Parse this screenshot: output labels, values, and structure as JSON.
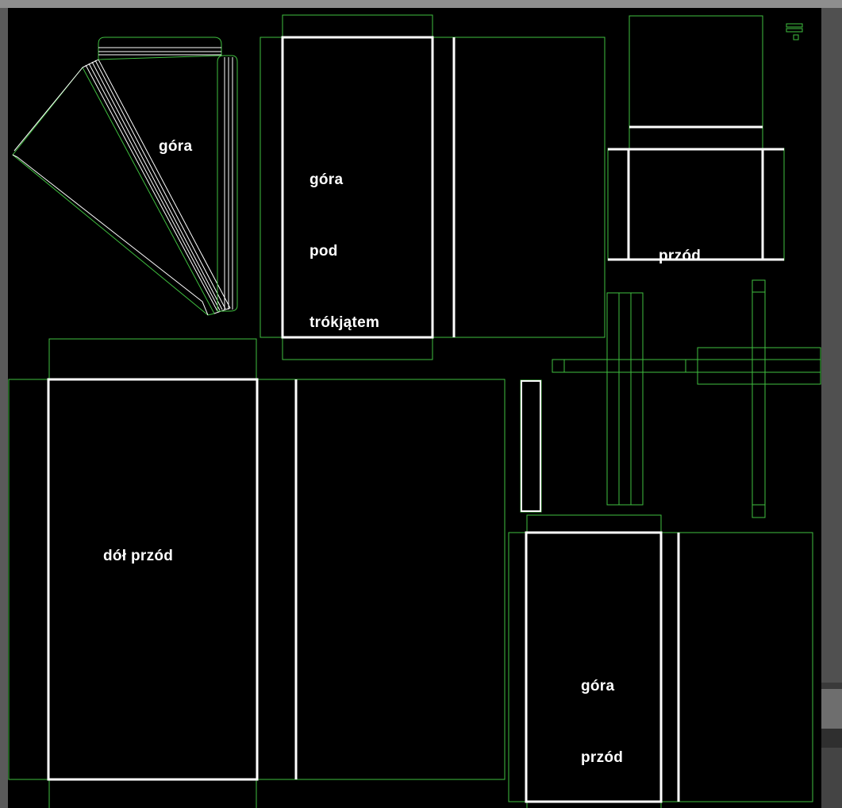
{
  "labels": {
    "gora": "góra",
    "gora_pod_trojkatem": [
      "góra",
      "pod",
      "trókjątem"
    ],
    "przod": "przód",
    "dol_przod": "dół przód",
    "gora_przod": [
      "góra",
      "przód"
    ]
  },
  "colors": {
    "background": "#000000",
    "uv_edge": "#3fbf3f",
    "seam_edge": "#ffffff",
    "label_text": "#ffffff",
    "frame": "#8e8e8e"
  }
}
